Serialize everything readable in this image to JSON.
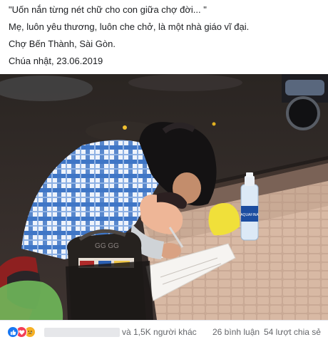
{
  "post": {
    "lines": [
      "\"Uốn nắn từng nét chữ cho con giữa chợ đời... \"",
      "Mẹ, luôn yêu thương, luôn che chở, là một nhà giáo vĩ đại.",
      "Chợ Bến Thành, Sài Gòn.",
      "Chúa nhật, 23.06.2019"
    ]
  },
  "photo": {
    "bottle_label": "AQUAFINA",
    "bag_text": "GG GG"
  },
  "footer": {
    "reaction_icons": [
      "like-icon",
      "love-icon",
      "sad-icon"
    ],
    "others_text": "và 1,5K người khác",
    "comments_text": "26 bình luận",
    "shares_text": "54 lượt chia sẻ"
  },
  "colors": {
    "like": "#1877f2",
    "love": "#f33e58",
    "sad": "#f7b125",
    "meta_text": "#65676b"
  }
}
